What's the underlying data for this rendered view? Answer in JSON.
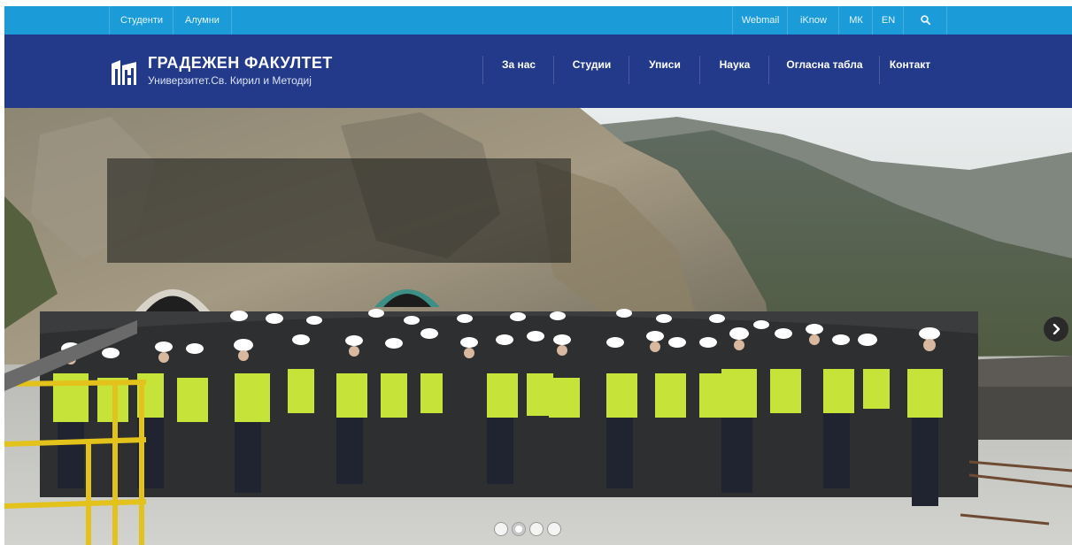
{
  "topbar": {
    "left_links": [
      "Студенти",
      "Алумни"
    ],
    "right_links": [
      "Webmail",
      "iKnow",
      "МК",
      "EN"
    ],
    "search_icon": "search-icon",
    "color": "#1b9bd7"
  },
  "header": {
    "logo_title": "ГРАДЕЖЕН ФАКУЛТЕТ",
    "logo_subtitle": "Универзитет.Св. Кирил и Методиј",
    "logo_icon": "faculty-logo-icon",
    "color": "#233a8b"
  },
  "nav": {
    "items": [
      "За нас",
      "Студии",
      "Уписи",
      "Наука",
      "Огласна табла",
      "Контакт"
    ]
  },
  "slider": {
    "slide_count": 4,
    "active_slide": 1,
    "next_icon": "chevron-right-icon"
  }
}
